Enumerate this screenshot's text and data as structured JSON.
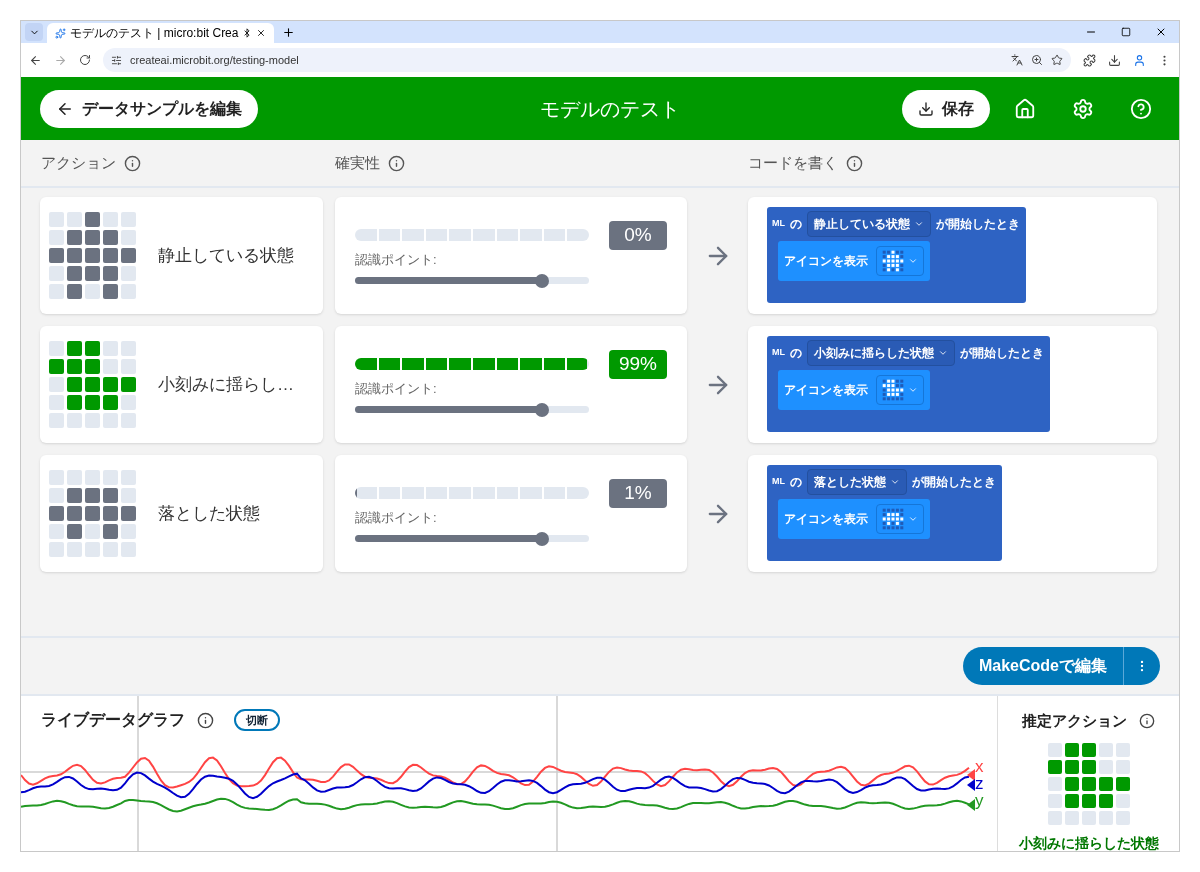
{
  "browser": {
    "tab_title": "モデルのテスト | micro:bit Crea",
    "url": "createai.microbit.org/testing-model"
  },
  "header": {
    "back_button": "データサンプルを編集",
    "title": "モデルのテスト",
    "save_button": "保存"
  },
  "columns": [
    "アクション",
    "確実性",
    "コードを書く"
  ],
  "actions": [
    {
      "name": "静止している状態",
      "recognized": false,
      "leds": [
        [
          false,
          false,
          true,
          false,
          false
        ],
        [
          false,
          true,
          true,
          true,
          false
        ],
        [
          true,
          true,
          true,
          true,
          true
        ],
        [
          false,
          true,
          true,
          true,
          false
        ],
        [
          false,
          true,
          false,
          true,
          false
        ]
      ],
      "certainty": "0%",
      "level": 0,
      "threshold_label": "認識ポイント:",
      "threshold": {
        "level": 0.8
      },
      "block": {
        "ml": "ML",
        "of": "の",
        "event": "静止している状態",
        "suffix": "が開始したとき",
        "statement": "アイコンを表示"
      }
    },
    {
      "name": "小刻みに揺らし…",
      "recognized": true,
      "leds": [
        [
          false,
          true,
          true,
          false,
          false
        ],
        [
          true,
          true,
          true,
          false,
          false
        ],
        [
          false,
          true,
          true,
          true,
          true
        ],
        [
          false,
          true,
          true,
          true,
          false
        ],
        [
          false,
          false,
          false,
          false,
          false
        ]
      ],
      "certainty": "99%",
      "level": 0.99,
      "threshold_label": "認識ポイント:",
      "threshold": {
        "level": 0.8
      },
      "block": {
        "ml": "ML",
        "of": "の",
        "event": "小刻みに揺らした状態",
        "suffix": "が開始したとき",
        "statement": "アイコンを表示"
      }
    },
    {
      "name": "落とした状態",
      "recognized": false,
      "leds": [
        [
          false,
          false,
          false,
          false,
          false
        ],
        [
          false,
          true,
          true,
          true,
          false
        ],
        [
          true,
          true,
          true,
          true,
          true
        ],
        [
          false,
          true,
          false,
          true,
          false
        ],
        [
          false,
          false,
          false,
          false,
          false
        ]
      ],
      "certainty": "1%",
      "level": 0.01,
      "threshold_label": "認識ポイント:",
      "threshold": {
        "level": 0.8
      },
      "block": {
        "ml": "ML",
        "of": "の",
        "event": "落とした状態",
        "suffix": "が開始したとき",
        "statement": "アイコンを表示"
      }
    }
  ],
  "makecode_button": "MakeCodeで編集",
  "live_graph": {
    "title": "ライブデータグラフ",
    "status_badge": "切断",
    "axes": [
      {
        "label": "x",
        "color": "#ff4444"
      },
      {
        "label": "z",
        "color": "#0000cc"
      },
      {
        "label": "y",
        "color": "#229922"
      }
    ]
  },
  "estimated": {
    "title": "推定アクション",
    "leds": [
      [
        false,
        true,
        true,
        false,
        false
      ],
      [
        true,
        true,
        true,
        false,
        false
      ],
      [
        false,
        true,
        true,
        true,
        true
      ],
      [
        false,
        true,
        true,
        true,
        false
      ],
      [
        false,
        false,
        false,
        false,
        false
      ]
    ],
    "name": "小刻みに揺らした状態"
  }
}
